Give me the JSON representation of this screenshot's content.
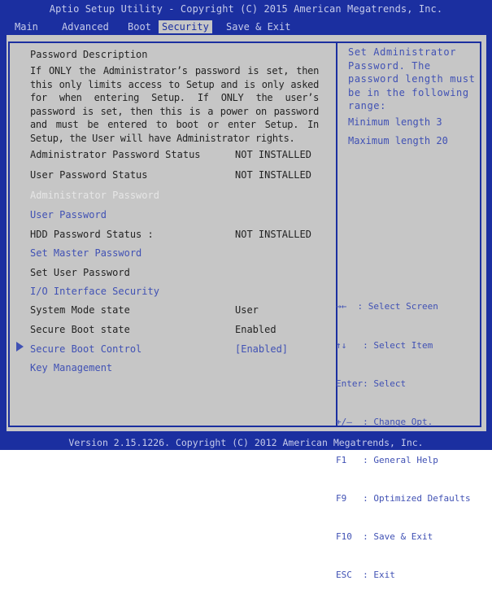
{
  "window": {
    "title": "Aptio Setup Utility - Copyright (C) 2015 American Megatrends, Inc.",
    "footer": "Version 2.15.1226. Copyright (C) 2012 American Megatrends, Inc."
  },
  "menu": {
    "tabs": [
      "Main",
      "Advanced",
      "Boot",
      "Security",
      "Save & Exit"
    ],
    "active": "Security"
  },
  "main": {
    "description_title": "Password Description",
    "description_body": "If ONLY the Administrator’s password is set, then this only limits access to Setup and is only asked for when entering Setup. If ONLY the user’s password is set, then this is a power on password and must be entered to boot or enter Setup. In Setup, the User will have Administrator rights.",
    "admin_status_label": "Administrator Password Status",
    "admin_status_value": "NOT INSTALLED",
    "user_status_label": "User Password Status",
    "user_status_value": "NOT INSTALLED",
    "admin_password": "Administrator Password",
    "user_password": "User Password",
    "hdd_status_label": "HDD Password Status :",
    "hdd_status_value": "NOT INSTALLED",
    "set_master_password": "Set Master Password",
    "set_user_password": "Set User Password",
    "io_interface_security": "I/O Interface Security",
    "system_mode_label": "System Mode state",
    "system_mode_value": "User",
    "secure_boot_state_label": "Secure Boot state",
    "secure_boot_state_value": "Enabled",
    "secure_boot_control_label": "Secure Boot Control",
    "secure_boot_control_value": "[Enabled]",
    "key_management": "Key Management"
  },
  "help": {
    "text": "Set Administrator Password. The password length must be in the following range:",
    "min_length": "Minimum length 3",
    "max_length": "Maximum length 20",
    "keys": [
      "→←  : Select Screen",
      "↑↓   : Select Item",
      "Enter: Select",
      "+/—  : Change Opt.",
      "F1   : General Help",
      "F9   : Optimized Defaults",
      "F10  : Save & Exit",
      "ESC  : Exit"
    ]
  }
}
